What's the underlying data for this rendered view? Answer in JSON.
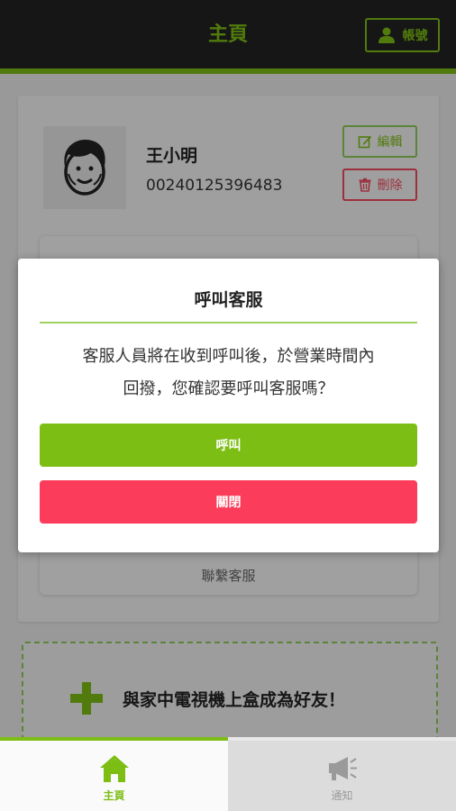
{
  "header": {
    "title": "主頁",
    "account_label": "帳號"
  },
  "profile": {
    "name": "王小明",
    "id": "00240125396483",
    "edit_label": "編輯",
    "delete_label": "刪除"
  },
  "contact_label": "聯繫客服",
  "add_device": {
    "label": "與家中電視機上盒成為好友！"
  },
  "bottom_nav": {
    "items": [
      {
        "label": "主頁",
        "icon": "home-icon",
        "active": true
      },
      {
        "label": "通知",
        "icon": "megaphone-icon",
        "active": false
      }
    ]
  },
  "modal": {
    "title": "呼叫客服",
    "message_line1": "客服人員將在收到呼叫後，於營業時間內",
    "message_line2": "回撥，您確認要呼叫客服嗎？",
    "call_label": "呼叫",
    "close_label": "關閉"
  },
  "colors": {
    "accent": "#7dbe15",
    "danger": "#fb3c5a",
    "header_bg": "#222222"
  }
}
